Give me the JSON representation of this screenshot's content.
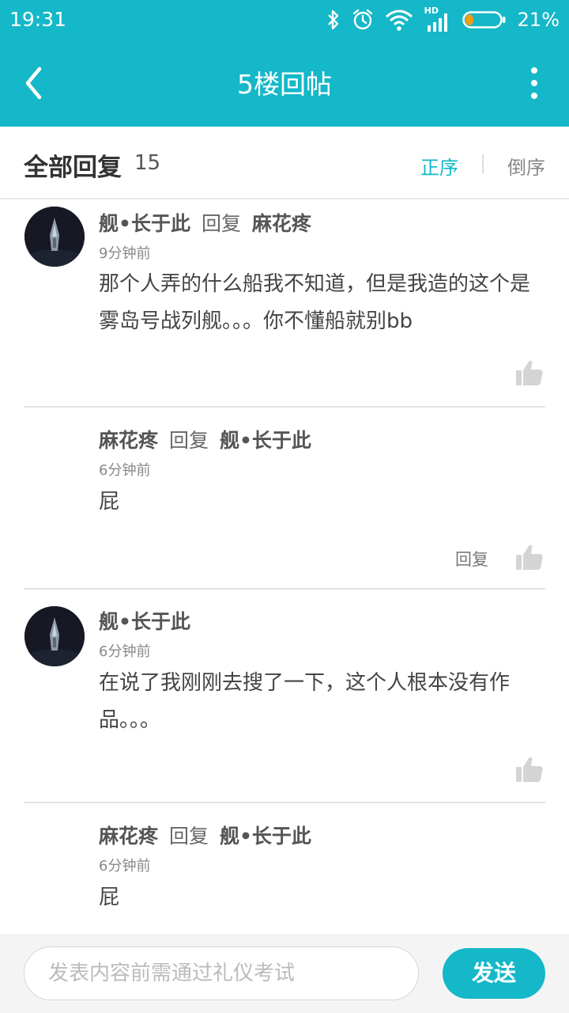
{
  "status_bar": {
    "time": "19:31",
    "battery_percent": "21%",
    "battery_level": 0.21,
    "network_label": "HD"
  },
  "toolbar": {
    "title": "5楼回帖"
  },
  "replies_header": {
    "title": "全部回复",
    "count": "15",
    "order_asc": "正序",
    "order_desc": "倒序"
  },
  "replies": [
    {
      "user": "舰•长于此",
      "reply_word": "回复",
      "target": "麻花疼",
      "time": "9分钟前",
      "content": "那个人弄的什么船我不知道，但是我造的这个是雾岛号战列舰。。。你不懂船就别bb"
    },
    {
      "user": "麻花疼",
      "reply_word": "回复",
      "target": "舰•长于此",
      "time": "6分钟前",
      "content": "屁",
      "reply_button": "回复"
    },
    {
      "user": "舰•长于此",
      "time": "6分钟前",
      "content": "在说了我刚刚去搜了一下，这个人根本没有作品。。。"
    },
    {
      "user": "麻花疼",
      "reply_word": "回复",
      "target": "舰•长于此",
      "time": "6分钟前",
      "content": "屁"
    }
  ],
  "composer": {
    "placeholder": "发表内容前需通过礼仪考试",
    "send_label": "发送"
  },
  "colors": {
    "accent": "#14b8c8",
    "battery_fill": "#f39c12"
  }
}
